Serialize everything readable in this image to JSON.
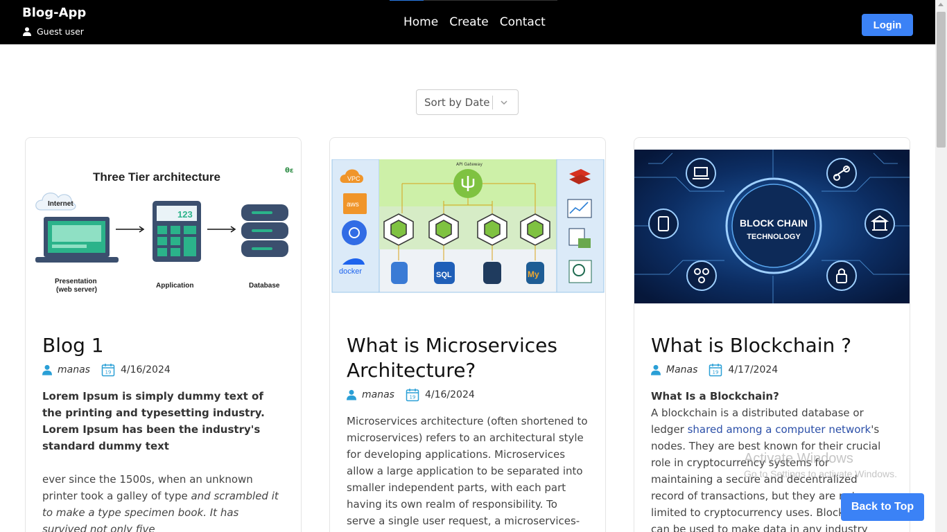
{
  "navbar": {
    "brand": "Blog-App",
    "user_label": "Guest user",
    "links": [
      "Home",
      "Create",
      "Contact"
    ],
    "login_label": "Login"
  },
  "sort": {
    "selected": "Sort by Date"
  },
  "cards": [
    {
      "image": {
        "title": "Three Tier architecture",
        "logo": "θε",
        "internet": "Internet",
        "presentation": "Presentation",
        "presentation_sub": "(web server)",
        "application": "Application",
        "app_screen": "123",
        "database": "Database"
      },
      "title": "Blog 1",
      "author": "manas",
      "date": "4/16/2024",
      "calendar_day": "19",
      "lead": "Lorem Ipsum is simply dummy text of the printing and typesetting industry. Lorem Ipsum has been the industry's standard dummy text",
      "p1_a": "ever since the 1500s, when an unknown printer took a galley of type ",
      "p1_b": "and scrambled it to make a type specimen book. It has survived not only five"
    },
    {
      "image": {
        "gateway": "API Gateway",
        "left_labels": [
          "VPC",
          "aws",
          "docker"
        ],
        "sql": "SQL",
        "my": "My"
      },
      "title": "What is Microservices Architecture?",
      "author": "manas",
      "date": "4/16/2024",
      "calendar_day": "19",
      "body": "Microservices architecture (often shortened to microservices) refers to an architectural style for developing applications. Microservices allow a large application to be separated into smaller independent parts, with each part having its own realm of responsibility. To serve a single user request, a microservices-based application can"
    },
    {
      "image": {
        "line1": "BLOCK CHAIN",
        "line2": "TECHNOLOGY"
      },
      "title": "What is Blockchain ?",
      "author": "Manas",
      "date": "4/17/2024",
      "calendar_day": "19",
      "subheading": "What Is a Blockchain?",
      "p_a": "A blockchain is a distributed database or ledger ",
      "p_link": "shared among a computer network",
      "p_b": "'s nodes. They are best known for their crucial role in cryptocurrency systems for maintaining a secure and decentralized record of transactions, but they are not limited to cryptocurrency uses. Blockchains can be used to make data in any industry immutable—the term for"
    }
  ],
  "watermark": {
    "line1": "Activate Windows",
    "line2": "Go to Settings to activate Windows."
  },
  "back_to_top": "Back to Top",
  "colors": {
    "accent": "#3b82f6",
    "navbar": "#000000",
    "meta_icon": "#2a9fd6",
    "link": "#2b4fa8"
  }
}
